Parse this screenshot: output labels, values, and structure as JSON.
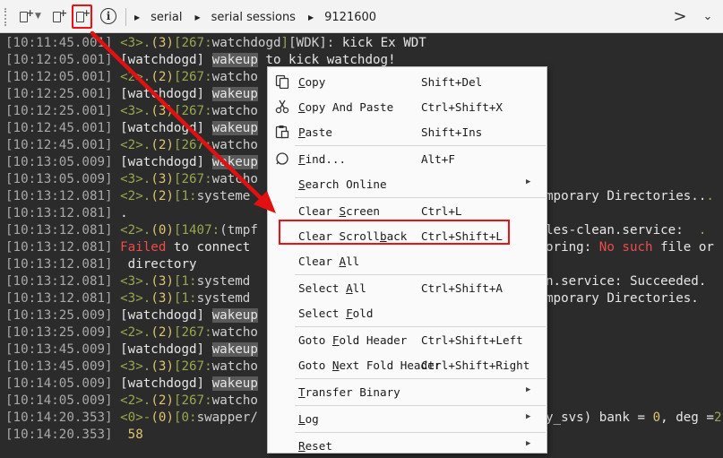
{
  "toolbar": {
    "breadcrumb": [
      "serial",
      "serial sessions",
      "9121600"
    ],
    "info_symbol": "i",
    "next_symbol": ">",
    "dropdown_symbol": "⌄",
    "plus_symbol": "+"
  },
  "terminal": {
    "lines": [
      {
        "ts": "[10:11:45.001]",
        "parts": [
          [
            "g",
            "<3>."
          ],
          [
            "y",
            "(3)"
          ],
          [
            "g",
            "[267:"
          ],
          [
            "c1",
            "watchdogd"
          ],
          [
            "g",
            "]"
          ],
          [
            "c1",
            "[WDK]: "
          ],
          [
            "w",
            "kick Ex WDT"
          ]
        ]
      },
      {
        "ts": "[10:12:05.001]",
        "parts": [
          [
            "w",
            "[watchdogd] "
          ],
          [
            "sel",
            "wakeup"
          ],
          [
            "w",
            " to kick watchdog!"
          ]
        ]
      },
      {
        "ts": "[10:12:05.001]",
        "parts": [
          [
            "g",
            "<2>."
          ],
          [
            "y",
            "(2)"
          ],
          [
            "g",
            "[267:"
          ],
          [
            "c1",
            "watcho"
          ]
        ]
      },
      {
        "ts": "[10:12:25.001]",
        "parts": [
          [
            "w",
            "[watchdogd] "
          ],
          [
            "sel",
            "wakeup"
          ]
        ]
      },
      {
        "ts": "[10:12:25.001]",
        "parts": [
          [
            "g",
            "<3>."
          ],
          [
            "y",
            "(3)"
          ],
          [
            "g",
            "[267:"
          ],
          [
            "c1",
            "watcho"
          ]
        ]
      },
      {
        "ts": "[10:12:45.001]",
        "parts": [
          [
            "w",
            "[watchdogd] "
          ],
          [
            "sel",
            "wakeup"
          ]
        ]
      },
      {
        "ts": "[10:12:45.001]",
        "parts": [
          [
            "g",
            "<2>."
          ],
          [
            "y",
            "(2)"
          ],
          [
            "g",
            "[267:"
          ],
          [
            "c1",
            "watcho"
          ]
        ]
      },
      {
        "ts": "[10:13:05.009]",
        "parts": [
          [
            "w",
            "[watchdogd] "
          ],
          [
            "sel",
            "wakeup"
          ]
        ]
      },
      {
        "ts": "[10:13:05.009]",
        "parts": [
          [
            "g",
            "<3>."
          ],
          [
            "y",
            "(3)"
          ],
          [
            "g",
            "[267:"
          ],
          [
            "c1",
            "watcho"
          ]
        ]
      },
      {
        "ts": "[10:13:12.081]",
        "parts": [
          [
            "g",
            "<2>."
          ],
          [
            "y",
            "(2)"
          ],
          [
            "g",
            "[1:"
          ],
          [
            "c1",
            "systeme"
          ]
        ]
      },
      {
        "ts": "[10:13:12.081]",
        "parts": [
          [
            "w",
            "."
          ]
        ]
      },
      {
        "ts": "[10:13:12.081]",
        "parts": [
          [
            "g",
            "<2>."
          ],
          [
            "y",
            "(0)"
          ],
          [
            "g",
            "[1407:"
          ],
          [
            "c1",
            "(tmpf"
          ]
        ]
      },
      {
        "ts": "[10:13:12.081]",
        "parts": [
          [
            "r",
            "Failed"
          ],
          [
            "w",
            " to connect"
          ]
        ]
      },
      {
        "ts": "[10:13:12.081]",
        "parts": [
          [
            "w",
            " directory"
          ]
        ]
      },
      {
        "ts": "[10:13:12.081]",
        "parts": [
          [
            "g",
            "<3>."
          ],
          [
            "y",
            "(3)"
          ],
          [
            "g",
            "[1:"
          ],
          [
            "c1",
            "systemd"
          ]
        ]
      },
      {
        "ts": "[10:13:12.081]",
        "parts": [
          [
            "g",
            "<3>."
          ],
          [
            "y",
            "(3)"
          ],
          [
            "g",
            "[1:"
          ],
          [
            "c1",
            "systemd"
          ]
        ]
      },
      {
        "ts": "[10:13:25.009]",
        "parts": [
          [
            "w",
            "[watchdogd] "
          ],
          [
            "sel",
            "wakeup"
          ]
        ]
      },
      {
        "ts": "[10:13:25.009]",
        "parts": [
          [
            "g",
            "<2>."
          ],
          [
            "y",
            "(2)"
          ],
          [
            "g",
            "[267:"
          ],
          [
            "c1",
            "watcho"
          ]
        ]
      },
      {
        "ts": "[10:13:45.009]",
        "parts": [
          [
            "w",
            "[watchdogd] "
          ],
          [
            "sel",
            "wakeup"
          ]
        ]
      },
      {
        "ts": "[10:13:45.009]",
        "parts": [
          [
            "g",
            "<3>."
          ],
          [
            "y",
            "(3)"
          ],
          [
            "g",
            "[267:"
          ],
          [
            "c1",
            "watcho"
          ]
        ]
      },
      {
        "ts": "[10:14:05.009]",
        "parts": [
          [
            "w",
            "[watchdogd] "
          ],
          [
            "sel",
            "wakeup"
          ]
        ]
      },
      {
        "ts": "[10:14:05.009]",
        "parts": [
          [
            "g",
            "<2>."
          ],
          [
            "y",
            "(2)"
          ],
          [
            "g",
            "[267:"
          ],
          [
            "c1",
            "watcho"
          ]
        ]
      },
      {
        "ts": "[10:14:20.353]",
        "parts": [
          [
            "g",
            "<0>-"
          ],
          [
            "y",
            "(0)"
          ],
          [
            "g",
            "[0:"
          ],
          [
            "c1",
            "swapper/"
          ]
        ]
      },
      {
        "ts": "[10:14:20.353]",
        "parts": [
          [
            "y",
            " 58"
          ]
        ]
      }
    ],
    "right_fragments": [
      {
        "row": 9,
        "parts": [
          [
            "w",
            "mporary Directories.."
          ],
          [
            "g",
            "."
          ]
        ]
      },
      {
        "row": 11,
        "parts": [
          [
            "w",
            "les-clean.service:  "
          ],
          [
            "g",
            "."
          ]
        ]
      },
      {
        "row": 12,
        "parts": [
          [
            "w",
            "oring: "
          ],
          [
            "r",
            "No such"
          ],
          [
            "w",
            " file or"
          ]
        ]
      },
      {
        "row": 14,
        "parts": [
          [
            "w",
            "n.service: Succeeded."
          ]
        ]
      },
      {
        "row": 15,
        "parts": [
          [
            "w",
            "mporary Directories."
          ]
        ]
      },
      {
        "row": 22,
        "parts": [
          [
            "w",
            "y_svs) bank = "
          ],
          [
            "y",
            "0"
          ],
          [
            "w",
            ", deg ="
          ],
          [
            "g",
            "2"
          ]
        ]
      }
    ]
  },
  "context_menu": {
    "items": [
      {
        "label": "Copy",
        "u": 0,
        "shortcut": "Shift+Del",
        "icon": "copy-icon"
      },
      {
        "label": "Copy And Paste",
        "u": 0,
        "shortcut": "Ctrl+Shift+X",
        "icon": "scissors-icon"
      },
      {
        "label": "Paste",
        "u": 0,
        "shortcut": "Shift+Ins",
        "icon": "paste-icon",
        "sep_after": true
      },
      {
        "label": "Find...",
        "u": 0,
        "shortcut": "Alt+F",
        "icon": "find-icon"
      },
      {
        "label": "Search Online",
        "u": 0,
        "shortcut": "",
        "submenu": true,
        "sep_after": true
      },
      {
        "label": "Clear Screen",
        "u": 6,
        "shortcut": "Ctrl+L"
      },
      {
        "label": "Clear Scrollback",
        "u": 12,
        "shortcut": "Ctrl+Shift+L"
      },
      {
        "label": "Clear All",
        "u": 6,
        "shortcut": "",
        "sep_after": true
      },
      {
        "label": "Select All",
        "u": 7,
        "shortcut": "Ctrl+Shift+A"
      },
      {
        "label": "Select Fold",
        "u": 7,
        "shortcut": "",
        "sep_after": true
      },
      {
        "label": "Goto Fold Header",
        "u": 5,
        "shortcut": "Ctrl+Shift+Left"
      },
      {
        "label": "Goto Next Fold Header",
        "u": 5,
        "shortcut": "Ctrl+Shift+Right",
        "sep_after": true
      },
      {
        "label": "Transfer Binary",
        "u": 0,
        "shortcut": "",
        "submenu": true,
        "sep_after": true
      },
      {
        "label": "Log",
        "u": 0,
        "shortcut": "",
        "submenu": true,
        "sep_after": true
      },
      {
        "label": "Reset",
        "u": 0,
        "shortcut": "",
        "submenu": true
      }
    ],
    "submenu_arrow": "▶"
  },
  "colors": {
    "highlight_red": "#e11111",
    "arrow_red": "#e11111",
    "terminal_bg": "#2b2b2b"
  }
}
